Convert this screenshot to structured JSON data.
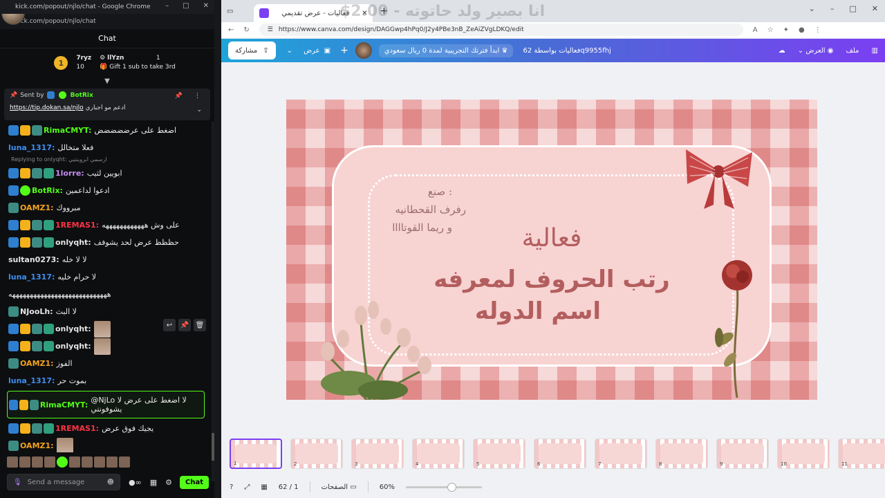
{
  "kick": {
    "window_url": "kick.com/popout/njlo/chat - Google Chrome",
    "address": "kick.com/popout/njlo/chat",
    "chat_title": "Chat",
    "gifters": {
      "rank": "1",
      "user1": "7ryz",
      "user1_count": "10",
      "user2": "llYzn",
      "user2_count": "1",
      "gift_prompt": "Gift 1 sub to take 3rd"
    },
    "pinned": {
      "sent_by": "Sent by",
      "bot": "BotRix",
      "prefix": "ادعم مو اجباري",
      "link": "https://tip.dokan.sa/njlo"
    },
    "messages": [
      {
        "user": "RimaCMYT:",
        "color": "#53fc18",
        "text": "اضغط على عرضضضضض"
      },
      {
        "user": "luna_1317:",
        "color": "#3f8ef0",
        "text": "فعلا متخالل"
      },
      {
        "reply": "Replying to onlyqht: ارسمي ابروينتيي"
      },
      {
        "user": "1lorre:",
        "color": "#c58cf3",
        "text": "ابويين لثيب"
      },
      {
        "user": "BotRix:",
        "color": "#53fc18",
        "text": "ادعوا لداعمين"
      },
      {
        "user": "OAMZ1:",
        "color": "#f2a21e",
        "text": "مبرووك"
      },
      {
        "user": "1REMAS1:",
        "color": "#ff3344",
        "text": "على وش ههههههههههههه"
      },
      {
        "user": "onlyqht:",
        "color": "#e6e6e6",
        "text": "حظظظ عرض لحد يشوفف"
      },
      {
        "user": "sultan0273:",
        "color": "#e6e6e6",
        "text": "لا لا خله"
      },
      {
        "user": "luna_1317:",
        "color": "#3f8ef0",
        "text": "لا حرام خليه"
      },
      {
        "text_only": "ههههههههههههههههههههههههههههه"
      },
      {
        "user": "NJooLh:",
        "color": "#e6e6e6",
        "text": "لا البث"
      },
      {
        "user": "onlyqht:",
        "color": "#e6e6e6",
        "text": ""
      },
      {
        "user": "onlyqht:",
        "color": "#e6e6e6",
        "text": ""
      },
      {
        "user": "OAMZ1:",
        "color": "#f2a21e",
        "text": "الفوز"
      },
      {
        "user": "luna_1317:",
        "color": "#3f8ef0",
        "text": "بموت حر"
      },
      {
        "user": "RimaCMYT:",
        "color": "#53fc18",
        "text": "@NjLo لا اضغط على عرض لا يشوفونتي"
      },
      {
        "user": "1REMAS1:",
        "color": "#ff3344",
        "text": "يجيك فوق عرض"
      },
      {
        "user": "OAMZ1:",
        "color": "#f2a21e",
        "text": ""
      }
    ],
    "input_placeholder": "Send a message",
    "chat_button": "Chat"
  },
  "canva": {
    "tab_title": "فعاليات - عرض تقديمي",
    "overlay": "$2.00 - انا بصير ولد حاتوته",
    "url": "https://www.canva.com/design/DAGGwp4hPq0/J2y4PBe3nB_ZeAiZVgLDKQ/edit",
    "toolbar": {
      "share": "مشاركة",
      "present": "عرض",
      "trial": "ابدأ فترتك التجريبية لمدة 0 ريال سعودي",
      "design_name": "فعاليات بواسطة 62q9955fhj",
      "resize": "العرض",
      "file": "ملف"
    },
    "slide": {
      "credit_label": "صنع :",
      "credit_1": "رفرف القحطانيه",
      "credit_2": "و ريما القوتاااا",
      "title_1": "فعالية",
      "title_2": "رتب الحروف لمعرفه",
      "title_3": "اسم الدوله"
    },
    "thumb_count": 11,
    "status": {
      "page_info": "62 / 1",
      "pages_label": "الصفحات",
      "zoom": "60%",
      "zoom_level": 0.6
    }
  }
}
